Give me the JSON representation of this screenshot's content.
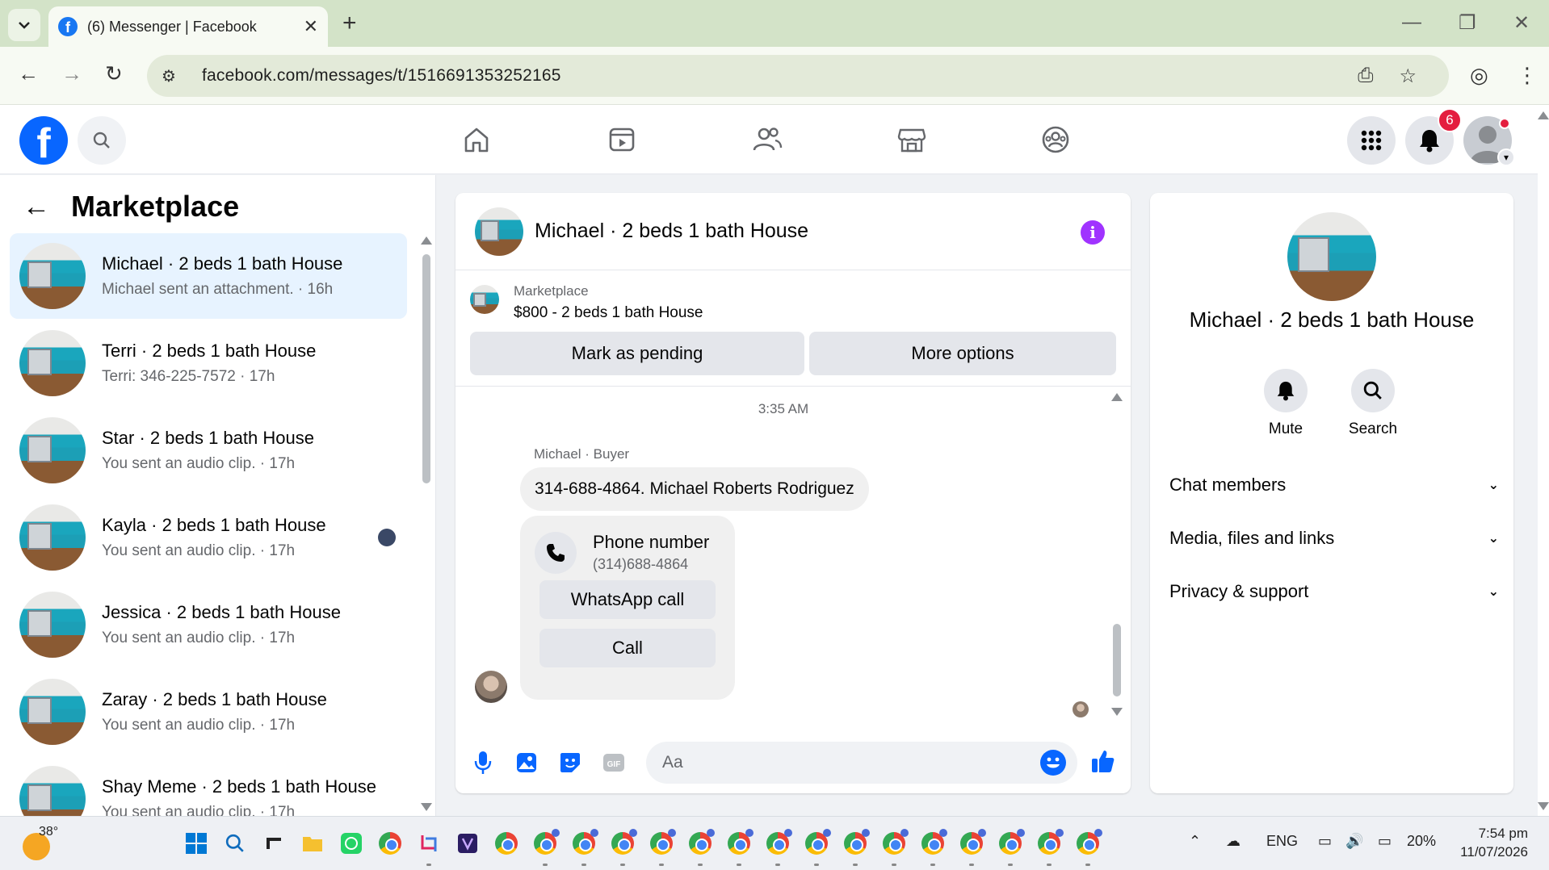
{
  "browser": {
    "tab_title": "(6) Messenger | Facebook",
    "url": "facebook.com/messages/t/1516691353252165"
  },
  "topbar": {
    "notifications_count": "6",
    "nav_icons": [
      "home-icon",
      "video-icon",
      "friends-icon",
      "marketplace-icon",
      "groups-icon"
    ]
  },
  "sidebar": {
    "title": "Marketplace",
    "conversations": [
      {
        "name": "Michael · 2 beds 1 bath House",
        "preview": "Michael sent an attachment. · 16h",
        "active": true
      },
      {
        "name": "Terri · 2 beds 1 bath House",
        "preview": "Terri: 346-225-7572 · 17h"
      },
      {
        "name": "Star · 2 beds 1 bath House",
        "preview": "You sent an audio clip. · 17h"
      },
      {
        "name": "Kayla · 2 beds 1 bath House",
        "preview": "You sent an audio clip. · 17h"
      },
      {
        "name": "Jessica · 2 beds 1 bath House",
        "preview": "You sent an audio clip. · 17h"
      },
      {
        "name": "Zaray · 2 beds 1 bath House",
        "preview": "You sent an audio clip. · 17h"
      },
      {
        "name": "Shay Meme · 2 beds 1 bath House",
        "preview": "You sent an audio clip. · 17h"
      }
    ]
  },
  "chat": {
    "title": "Michael · 2 beds 1 bath House",
    "marketplace_label": "Marketplace",
    "listing": "$800 - 2 beds 1 bath House",
    "mark_pending": "Mark as pending",
    "more_options": "More options",
    "timestamp": "3:35 AM",
    "sender": "Michael · Buyer",
    "message": "314-688-4864. Michael Roberts Rodriguez",
    "phone_card": {
      "title": "Phone number",
      "number": "(314)688-4864",
      "whatsapp": "WhatsApp call",
      "call": "Call"
    },
    "input_placeholder": "Aa"
  },
  "details": {
    "name": "Michael · 2 beds 1 bath House",
    "mute": "Mute",
    "search": "Search",
    "sections": [
      "Chat members",
      "Media, files and links",
      "Privacy & support"
    ]
  },
  "taskbar": {
    "temperature": "38°",
    "language": "ENG",
    "battery": "20%",
    "time": "7:54 pm",
    "date": "11/07/2026"
  },
  "colors": {
    "fb_blue": "#0866ff",
    "active_conv": "#e7f3ff",
    "info_purple": "#a033ff"
  }
}
